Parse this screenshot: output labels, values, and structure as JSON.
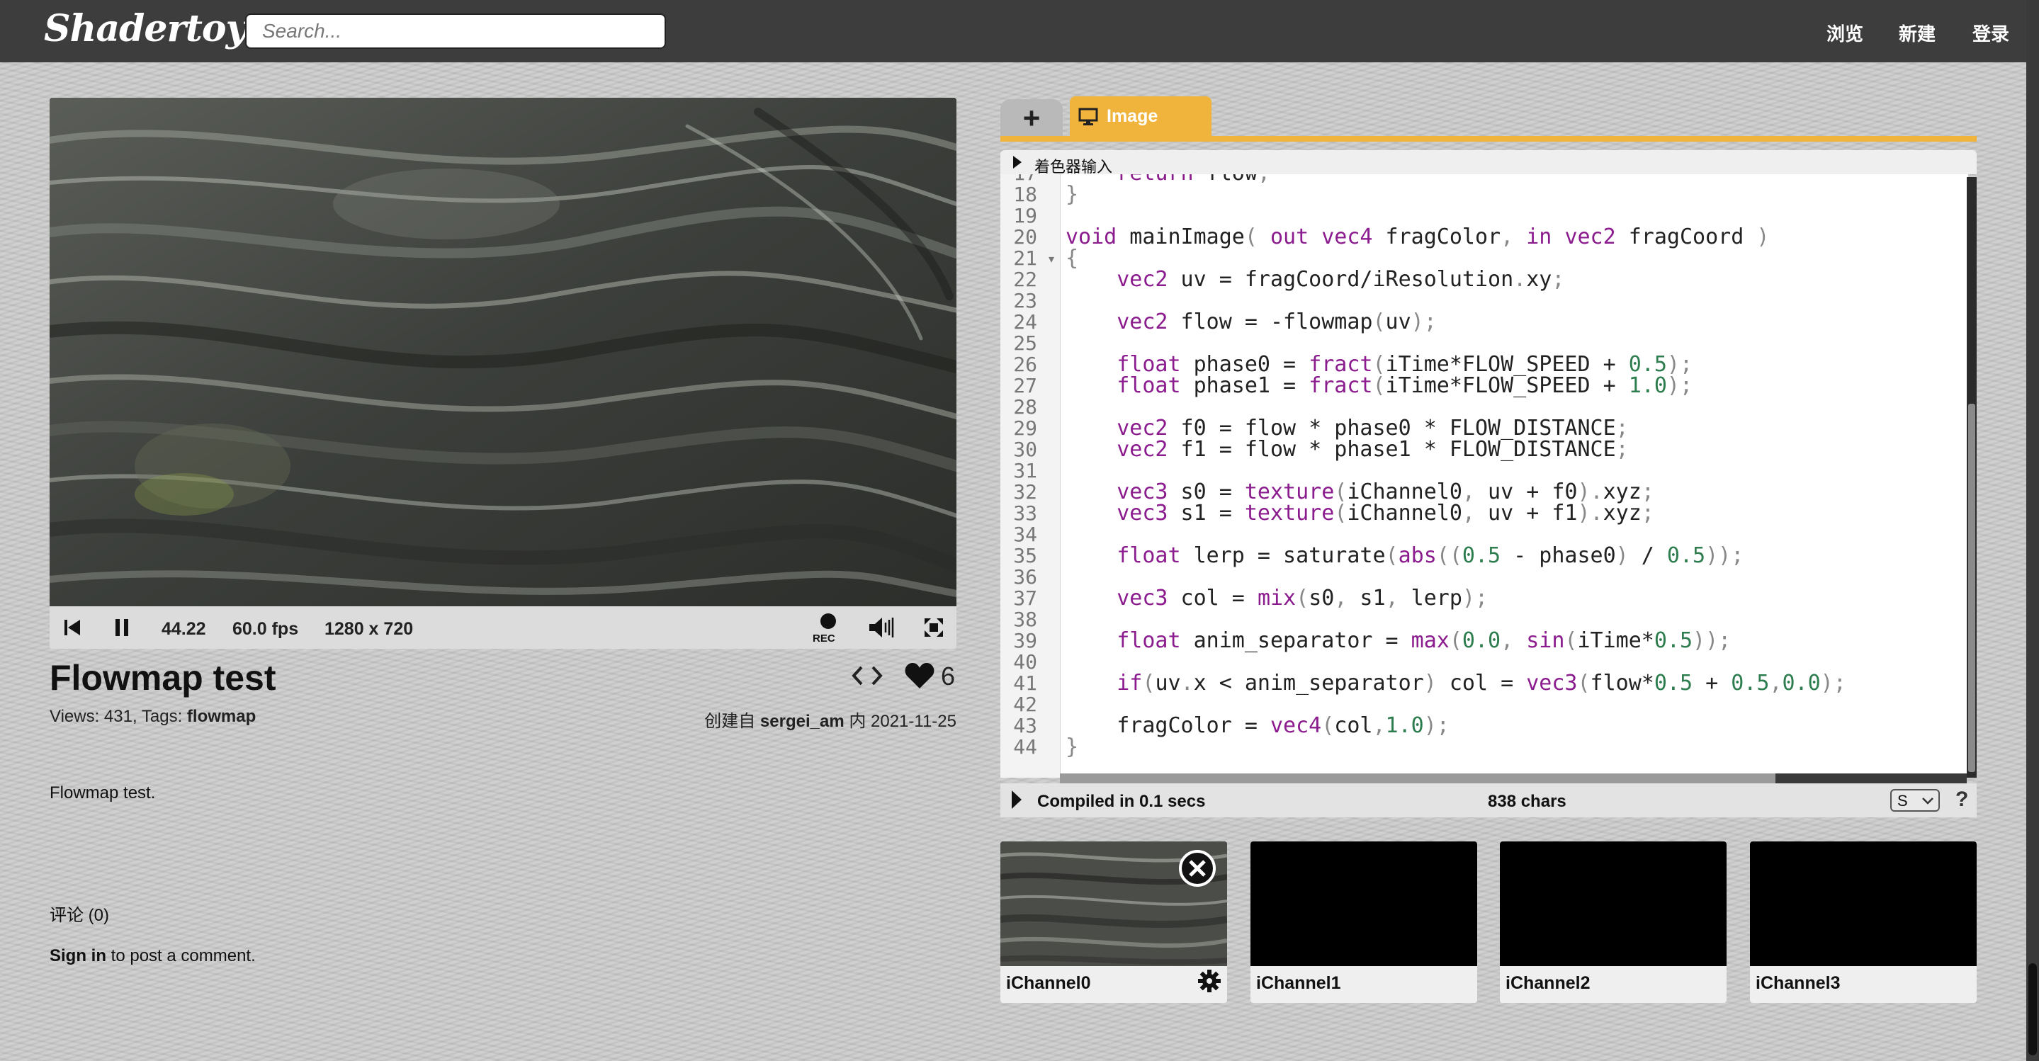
{
  "header": {
    "logo": "Shadertoy",
    "search_placeholder": "Search...",
    "nav": [
      "浏览",
      "新建",
      "登录"
    ]
  },
  "player": {
    "time": "44.22",
    "fps": "60.0 fps",
    "resolution": "1280 x 720",
    "rec_label": "REC"
  },
  "shader": {
    "title": "Flowmap test",
    "views_prefix": "Views: 431, Tags: ",
    "tag": "flowmap",
    "created_prefix": "创建自 ",
    "author": "sergei_am",
    "created_suffix": " 内 2021-11-25",
    "likes": "6",
    "description": "Flowmap test.",
    "comments_label": "评论 (0)",
    "signin_link": "Sign in",
    "signin_rest": " to post a comment."
  },
  "editor": {
    "tab_image": "Image",
    "inputs_label": "着色器输入",
    "line_numbers": [
      "17",
      "18",
      "19",
      "20",
      "21",
      "22",
      "23",
      "24",
      "25",
      "26",
      "27",
      "28",
      "29",
      "30",
      "31",
      "32",
      "33",
      "34",
      "35",
      "36",
      "37",
      "38",
      "39",
      "40",
      "41",
      "42",
      "43",
      "44"
    ],
    "status_compiled": "Compiled in 0.1 secs",
    "status_chars": "838 chars",
    "select_value": "S",
    "help": "?"
  },
  "channels": [
    "iChannel0",
    "iChannel1",
    "iChannel2",
    "iChannel3"
  ],
  "colors": {
    "accent": "#f0b43c",
    "topbar": "#3d3d3d",
    "keyword": "#8b1c8e",
    "number": "#2e7d4f"
  },
  "icons": [
    "rewind-icon",
    "pause-icon",
    "record-icon",
    "volume-icon",
    "fullscreen-icon",
    "code-icon",
    "heart-icon",
    "monitor-icon",
    "play-triangle-icon",
    "close-icon",
    "gear-icon"
  ]
}
